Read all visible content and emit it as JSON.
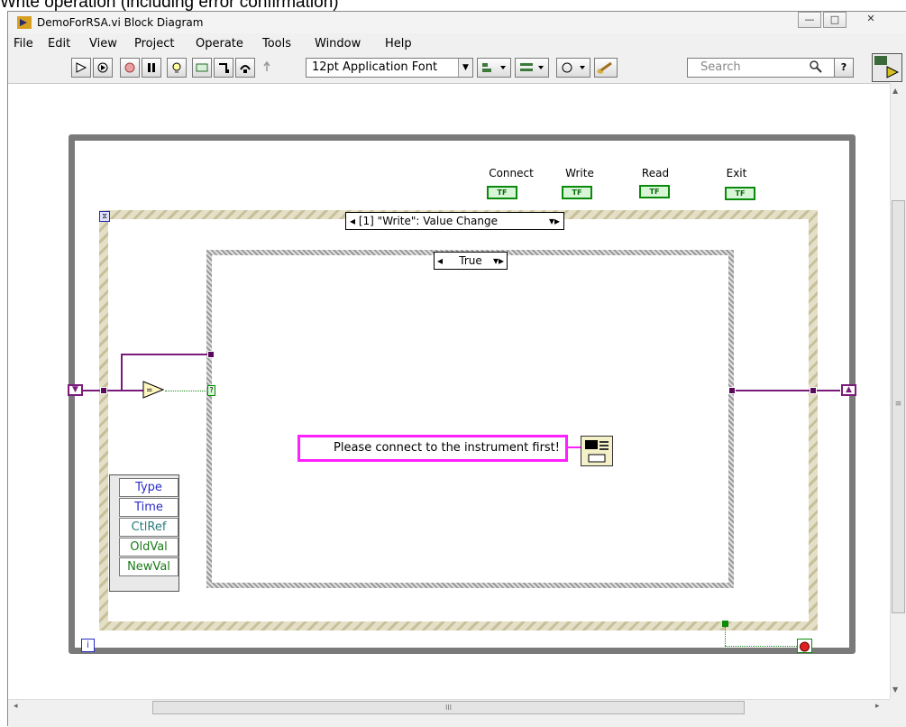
{
  "caption": "Write operation (including error confirmation)",
  "window": {
    "title": "DemoForRSA.vi Block Diagram",
    "min_glyph": "—",
    "max_glyph": "□",
    "close_glyph": "✕"
  },
  "menu": [
    {
      "label": "File"
    },
    {
      "label": "Edit"
    },
    {
      "label": "View"
    },
    {
      "label": "Project"
    },
    {
      "label": "Operate"
    },
    {
      "label": "Tools"
    },
    {
      "label": "Window"
    },
    {
      "label": "Help"
    }
  ],
  "toolbar": {
    "font": "12pt Application Font",
    "search_placeholder": "Search",
    "help_glyph": "?"
  },
  "diagram": {
    "booleans": [
      {
        "label": "Connect",
        "term": "TF"
      },
      {
        "label": "Write",
        "term": "TF"
      },
      {
        "label": "Read",
        "term": "TF"
      },
      {
        "label": "Exit",
        "term": "TF"
      }
    ],
    "event_selector": "[1] \"Write\": Value Change",
    "case_selector": "True",
    "unbundle": [
      "Type",
      "Time",
      "CtlRef",
      "OldVal",
      "NewVal"
    ],
    "message": "Please connect to the instrument first!",
    "loop_index": "i"
  },
  "scrollbar": {
    "h_thumb_glyph": "III",
    "v_thumb_glyph": "≡"
  },
  "colors": {
    "loop_border": "#7a7a7a",
    "wire_purple": "#7a1a7a",
    "string_border": "#ff20ff",
    "bool_green": "#0a8a0a"
  }
}
